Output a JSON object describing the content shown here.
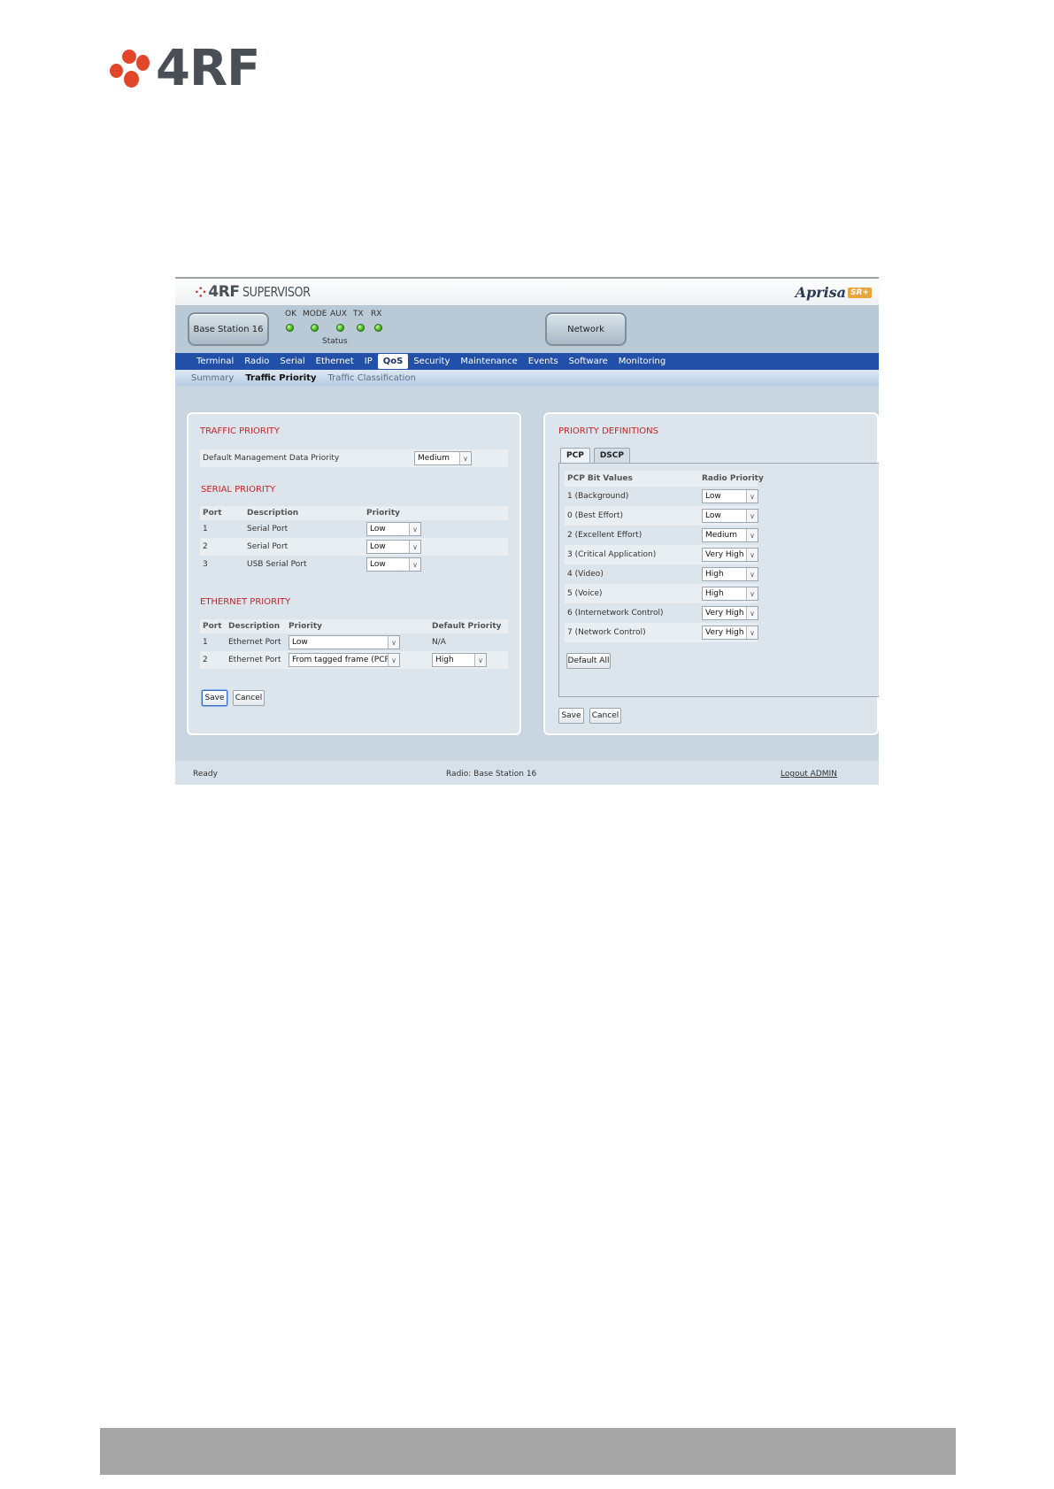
{
  "page": {
    "logo_text": "4RF",
    "brand_color": "#e2462a"
  },
  "app": {
    "logo_mark": "4RF",
    "logo_text": "SUPERVISOR",
    "brand": "Aprisa",
    "brand_tag": "SR+"
  },
  "header": {
    "station_button": "Base Station 16",
    "network_button": "Network",
    "leds": [
      "OK",
      "MODE",
      "AUX",
      "TX",
      "RX"
    ],
    "led_color": "#3fb21a",
    "status_label": "Status"
  },
  "nav": {
    "items": [
      "Terminal",
      "Radio",
      "Serial",
      "Ethernet",
      "IP",
      "QoS",
      "Security",
      "Maintenance",
      "Events",
      "Software",
      "Monitoring"
    ],
    "active": "QoS"
  },
  "subnav": {
    "items": [
      "Summary",
      "Traffic Priority",
      "Traffic Classification"
    ],
    "active": "Traffic Priority"
  },
  "traffic_priority": {
    "title": "TRAFFIC PRIORITY",
    "default_mgmt_label": "Default Management Data Priority",
    "default_mgmt_value": "Medium",
    "serial": {
      "title": "SERIAL PRIORITY",
      "headers": [
        "Port",
        "Description",
        "Priority"
      ],
      "rows": [
        {
          "port": "1",
          "description": "Serial Port",
          "priority": "Low"
        },
        {
          "port": "2",
          "description": "Serial Port",
          "priority": "Low"
        },
        {
          "port": "3",
          "description": "USB Serial Port",
          "priority": "Low"
        }
      ]
    },
    "ethernet": {
      "title": "ETHERNET PRIORITY",
      "headers": [
        "Port",
        "Description",
        "Priority",
        "Default Priority"
      ],
      "rows": [
        {
          "port": "1",
          "description": "Ethernet Port",
          "priority": "Low",
          "default": "N/A"
        },
        {
          "port": "2",
          "description": "Ethernet Port",
          "priority": "From tagged frame (PCP)",
          "default": "High"
        }
      ]
    },
    "save": "Save",
    "cancel": "Cancel"
  },
  "priority_definitions": {
    "title": "PRIORITY DEFINITIONS",
    "tabs": [
      "PCP",
      "DSCP"
    ],
    "active_tab": "PCP",
    "headers": [
      "PCP Bit Values",
      "Radio Priority"
    ],
    "rows": [
      {
        "value": "1 (Background)",
        "priority": "Low"
      },
      {
        "value": "0 (Best Effort)",
        "priority": "Low"
      },
      {
        "value": "2 (Excellent Effort)",
        "priority": "Medium"
      },
      {
        "value": "3 (Critical Application)",
        "priority": "Very High"
      },
      {
        "value": "4 (Video)",
        "priority": "High"
      },
      {
        "value": "5 (Voice)",
        "priority": "High"
      },
      {
        "value": "6 (Internetwork Control)",
        "priority": "Very High"
      },
      {
        "value": "7 (Network Control)",
        "priority": "Very High"
      }
    ],
    "default_all": "Default All",
    "save": "Save",
    "cancel": "Cancel"
  },
  "footer": {
    "status": "Ready",
    "radio": "Radio: Base Station 16",
    "logout": "Logout ADMIN"
  }
}
